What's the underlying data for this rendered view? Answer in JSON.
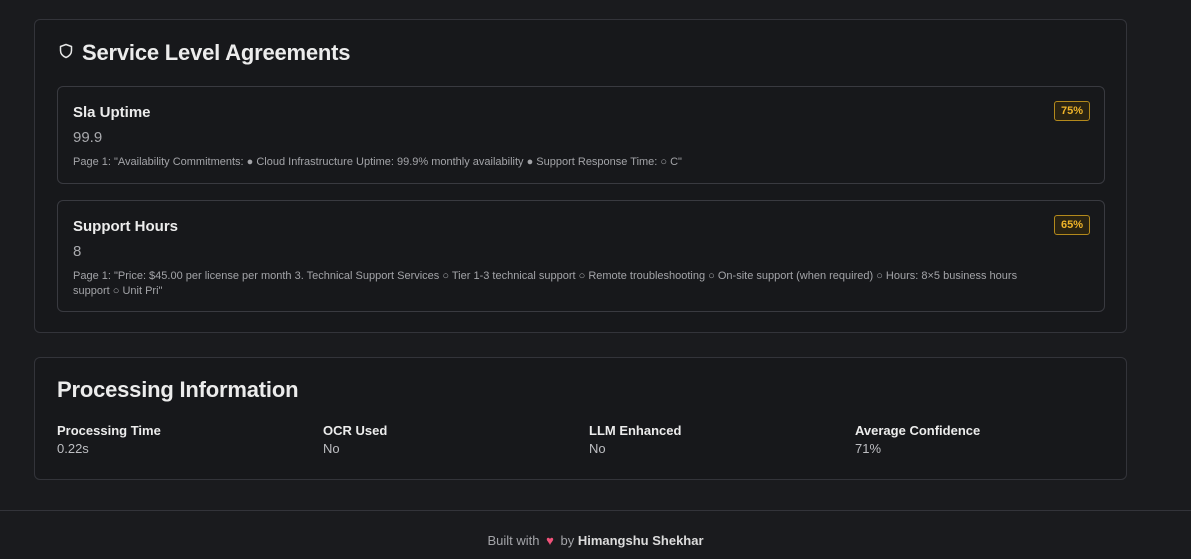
{
  "sla": {
    "title": "Service Level Agreements",
    "icon": "shield-icon",
    "items": [
      {
        "name": "Sla Uptime",
        "value": "99.9",
        "confidence": "75%",
        "excerpt": "Page 1: \"Availability Commitments: ● Cloud Infrastructure Uptime: 99.9% monthly availability ● Support Response Time: ○ C\""
      },
      {
        "name": "Support Hours",
        "value": "8",
        "confidence": "65%",
        "excerpt": "Page 1: \"Price: $45.00 per license per month 3. Technical Support Services ○ Tier 1-3 technical support ○ Remote troubleshooting ○ On-site support (when required) ○ Hours: 8×5 business hours support ○ Unit Pri\""
      }
    ]
  },
  "processing": {
    "title": "Processing Information",
    "metrics": [
      {
        "label": "Processing Time",
        "value": "0.22s"
      },
      {
        "label": "OCR Used",
        "value": "No"
      },
      {
        "label": "LLM Enhanced",
        "value": "No"
      },
      {
        "label": "Average Confidence",
        "value": "71%"
      }
    ]
  },
  "footer": {
    "prefix": "Built with",
    "heart": "♥",
    "by": "by",
    "author": "Himangshu Shekhar"
  },
  "colors": {
    "background": "#1a1b1e",
    "badge_accent": "#f0b429",
    "heart": "#f0527a"
  }
}
